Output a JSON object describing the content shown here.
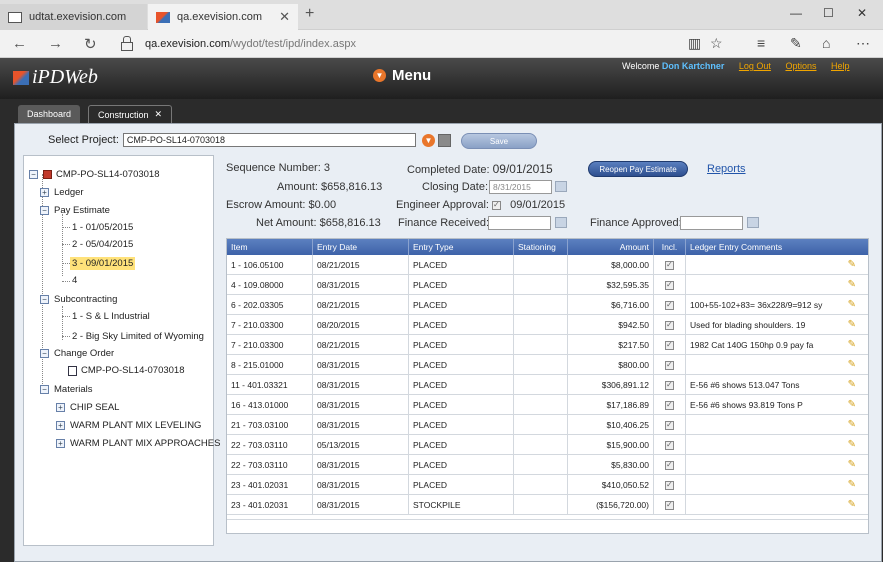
{
  "browser": {
    "tabs": [
      {
        "title": "udtat.exevision.com",
        "active": false
      },
      {
        "title": "qa.exevision.com",
        "active": true
      }
    ],
    "new_tab": "+",
    "window_controls": {
      "minimize": "—",
      "maximize": "☐",
      "close": "✕"
    },
    "url_domain": "qa.exevision.com",
    "url_path": "/wydot/test/ipd/index.aspx",
    "url_prefix": "qa."
  },
  "app": {
    "logo_text": "iPDWeb",
    "menu_label": "Menu",
    "welcome_label": "Welcome",
    "user_name": "Don Kartchner",
    "links": [
      "Log Out",
      "Options",
      "Help"
    ],
    "tabs": [
      {
        "label": "Dashboard"
      },
      {
        "label": "Construction",
        "close": "✕"
      }
    ]
  },
  "project": {
    "label": "Select Project:",
    "value": "CMP-PO-SL14-0703018",
    "save_label": "Save"
  },
  "tree": {
    "root": "CMP-PO-SL14-0703018",
    "ledger": "Ledger",
    "pay_estimate": "Pay Estimate",
    "pay_items": [
      "1 - 01/05/2015",
      "2 - 05/04/2015",
      "3 - 09/01/2015",
      "4"
    ],
    "subcontracting": "Subcontracting",
    "sub_items": [
      "1 - S & L Industrial",
      "2 - Big Sky Limited of Wyoming"
    ],
    "change_order": "Change Order",
    "co_items": [
      "CMP-PO-SL14-0703018"
    ],
    "materials": "Materials",
    "mat_items": [
      "CHIP SEAL",
      "WARM PLANT MIX LEVELING",
      "WARM PLANT MIX APPROACHES"
    ]
  },
  "summary": {
    "seq_label": "Sequence Number:",
    "seq_value": "3",
    "amount_label": "Amount:",
    "amount_value": "$658,816.13",
    "escrow_label": "Escrow Amount:",
    "escrow_value": "$0.00",
    "net_label": "Net Amount:",
    "net_value": "$658,816.13",
    "completed_label": "Completed Date:",
    "completed_value": "09/01/2015",
    "closing_label": "Closing Date:",
    "closing_value": "8/31/2015",
    "eng_label": "Engineer Approval:",
    "eng_value": "09/01/2015",
    "fin_recv_label": "Finance Received:",
    "fin_appr_label": "Finance Approved:",
    "reopen_label": "Reopen Pay Estimate",
    "reports_label": "Reports"
  },
  "grid": {
    "headers": [
      "Item",
      "Entry Date",
      "Entry Type",
      "Stationing",
      "Amount",
      "Incl.",
      "Ledger Entry Comments"
    ],
    "rows": [
      [
        "1 - 106.05100",
        "08/21/2015",
        "PLACED",
        "",
        "$8,000.00",
        "",
        ""
      ],
      [
        "4 - 109.08000",
        "08/31/2015",
        "PLACED",
        "",
        "$32,595.35",
        "",
        ""
      ],
      [
        "6 - 202.03305",
        "08/21/2015",
        "PLACED",
        "",
        "$6,716.00",
        "",
        "100+55-102+83= 36x228/9=912 sy"
      ],
      [
        "7 - 210.03300",
        "08/20/2015",
        "PLACED",
        "",
        "$942.50",
        "",
        "Used for blading shoulders. 19"
      ],
      [
        "7 - 210.03300",
        "08/21/2015",
        "PLACED",
        "",
        "$217.50",
        "",
        "1982 Cat 140G 150hp 0.9 pay fa"
      ],
      [
        "8 - 215.01000",
        "08/31/2015",
        "PLACED",
        "",
        "$800.00",
        "",
        ""
      ],
      [
        "11 - 401.03321",
        "08/31/2015",
        "PLACED",
        "",
        "$306,891.12",
        "",
        "E-56 #6 shows 513.047 Tons"
      ],
      [
        "16 - 413.01000",
        "08/31/2015",
        "PLACED",
        "",
        "$17,186.89",
        "",
        "E-56 #6 shows 93.819 Tons P"
      ],
      [
        "21 - 703.03100",
        "08/31/2015",
        "PLACED",
        "",
        "$10,406.25",
        "",
        ""
      ],
      [
        "22 - 703.03110",
        "05/13/2015",
        "PLACED",
        "",
        "$15,900.00",
        "",
        ""
      ],
      [
        "22 - 703.03110",
        "08/31/2015",
        "PLACED",
        "",
        "$5,830.00",
        "",
        ""
      ],
      [
        "23 - 401.02031",
        "08/31/2015",
        "PLACED",
        "",
        "$410,050.52",
        "",
        ""
      ],
      [
        "23 - 401.02031",
        "08/31/2015",
        "STOCKPILE",
        "",
        "($156,720.00)",
        "",
        ""
      ]
    ]
  }
}
